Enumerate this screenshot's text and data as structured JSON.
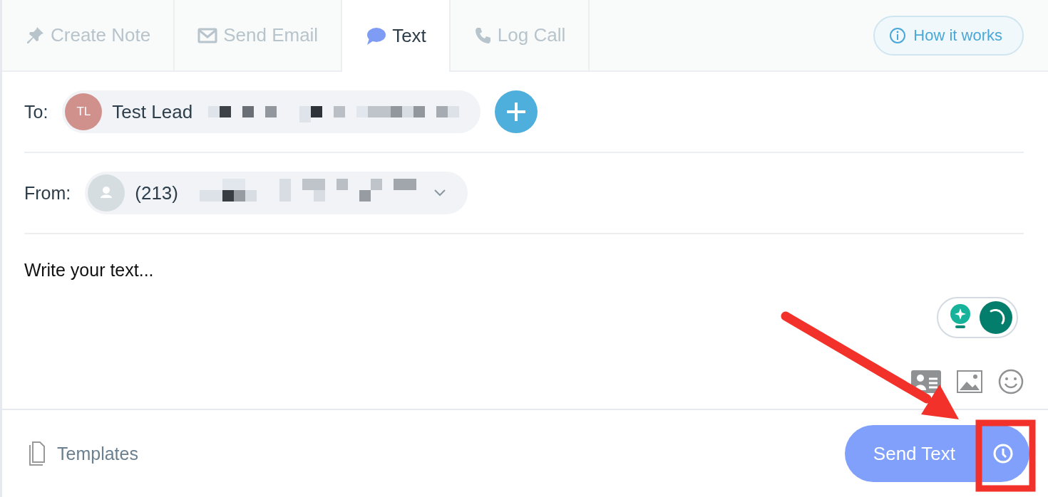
{
  "tabs": [
    {
      "label": "Create Note",
      "kind": "pin",
      "selected": false
    },
    {
      "label": "Send Email",
      "kind": "mail",
      "selected": false
    },
    {
      "label": "Text",
      "kind": "chat",
      "selected": true
    },
    {
      "label": "Log Call",
      "kind": "phone",
      "selected": false
    }
  ],
  "help_button": {
    "label": "How it works"
  },
  "to": {
    "label": "To:",
    "initials": "TL",
    "name": "Test Lead"
  },
  "from": {
    "label": "From:",
    "number": "(213)"
  },
  "message": {
    "placeholder": "Write your text..."
  },
  "footer": {
    "templates": "Templates",
    "send_button": "Send Text"
  }
}
